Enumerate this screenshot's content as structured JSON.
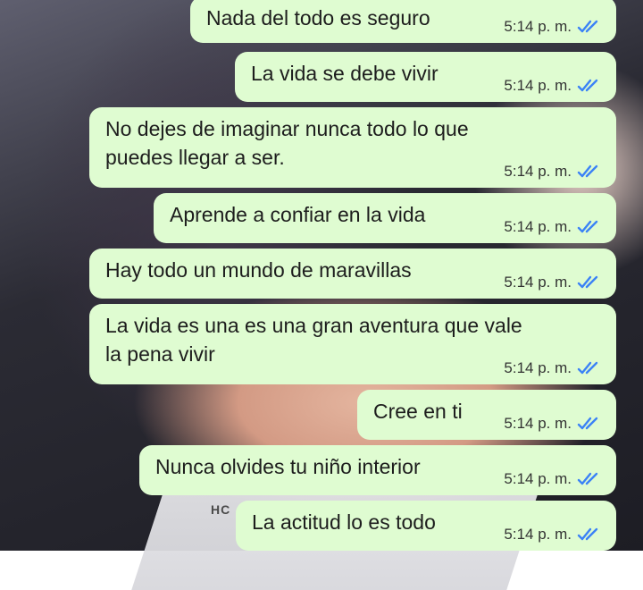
{
  "messages": [
    {
      "text": "Nada del todo es seguro",
      "time": "5:14 p. m.",
      "status": "read",
      "status_icon": "double-check-icon",
      "check_color": "#3b82f6"
    },
    {
      "text": "La vida se debe vivir",
      "time": "5:14 p. m.",
      "status": "read",
      "status_icon": "double-check-icon",
      "check_color": "#3b82f6"
    },
    {
      "text": "No dejes de imaginar nunca todo lo que\npuedes llegar a ser.",
      "time": "5:14 p. m.",
      "status": "read",
      "status_icon": "double-check-icon",
      "check_color": "#3b82f6"
    },
    {
      "text": "Aprende a confiar en la vida",
      "time": "5:14 p. m.",
      "status": "read",
      "status_icon": "double-check-icon",
      "check_color": "#3b82f6"
    },
    {
      "text": "Hay todo un mundo de maravillas",
      "time": "5:14 p. m.",
      "status": "read",
      "status_icon": "double-check-icon",
      "check_color": "#3b82f6"
    },
    {
      "text": "La vida es una es una gran aventura que vale\nla pena vivir",
      "time": "5:14 p. m.",
      "status": "read",
      "status_icon": "double-check-icon",
      "check_color": "#3b82f6"
    },
    {
      "text": "Cree en ti",
      "time": "5:14 p. m.",
      "status": "read",
      "status_icon": "double-check-icon",
      "check_color": "#3b82f6"
    },
    {
      "text": "Nunca olvides tu niño interior",
      "time": "5:14 p. m.",
      "status": "read",
      "status_icon": "double-check-icon",
      "check_color": "#3b82f6"
    },
    {
      "text": "La actitud lo es todo",
      "time": "5:14 p. m.",
      "status": "read",
      "status_icon": "double-check-icon",
      "check_color": "#3b82f6"
    }
  ],
  "wallpaper": {
    "watermark_text": "HC"
  },
  "colors": {
    "bubble_bg": "#dffcd1",
    "check_blue": "#3b82f6"
  }
}
